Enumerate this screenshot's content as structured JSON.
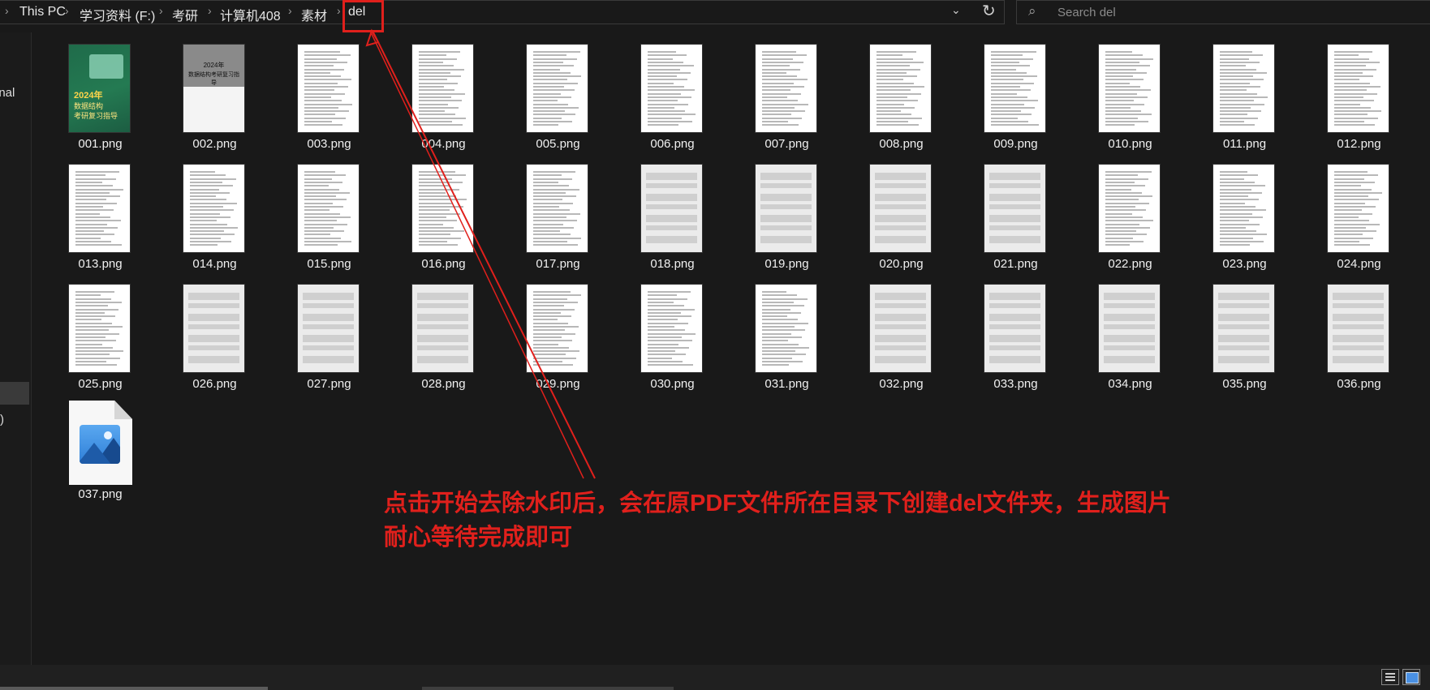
{
  "breadcrumb": {
    "items": [
      "This PC",
      "学习资料 (F:)",
      "考研",
      "计算机408",
      "素材",
      "del"
    ],
    "separator_icon": "chevron-right-icon"
  },
  "address_dropdown_icon": "chevron-down-icon",
  "refresh_icon": "refresh-icon",
  "search": {
    "placeholder": "Search del",
    "icon": "search-icon"
  },
  "nav_pane": {
    "visible_label_1": "onal",
    "visible_label_2": ")"
  },
  "files": [
    "001.png",
    "002.png",
    "003.png",
    "004.png",
    "005.png",
    "006.png",
    "007.png",
    "008.png",
    "009.png",
    "010.png",
    "011.png",
    "012.png",
    "013.png",
    "014.png",
    "015.png",
    "016.png",
    "017.png",
    "018.png",
    "019.png",
    "020.png",
    "021.png",
    "022.png",
    "023.png",
    "024.png",
    "025.png",
    "026.png",
    "027.png",
    "028.png",
    "029.png",
    "030.png",
    "031.png",
    "032.png",
    "033.png",
    "034.png",
    "035.png",
    "036.png",
    "037.png"
  ],
  "cover1": {
    "line1": "2024年",
    "line2": "数据结构",
    "line3": "考研复习指导"
  },
  "cover2": {
    "line1": "2024年",
    "line2": "数据结构考研复习指导"
  },
  "annotation": {
    "line1": "点击开始去除水印后，会在原PDF文件所在目录下创建del文件夹，生成图片",
    "line2": "耐心等待完成即可",
    "color": "#e0201c"
  },
  "view_buttons": {
    "details_icon": "details-view-icon",
    "large_icon": "large-icons-view-icon"
  }
}
